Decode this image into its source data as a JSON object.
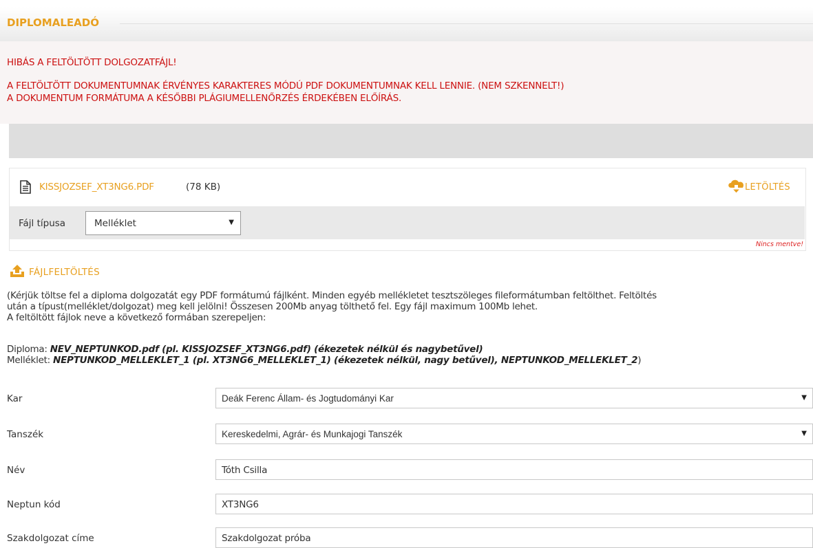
{
  "header": {
    "title": "DIPLOMALEADÓ"
  },
  "errors": {
    "line1": "HIBÁS A FELTÖLTÖTT DOLGOZATFÁJL!",
    "line2": "A FELTÖLTÖTT DOKUMENTUMNAK ÉRVÉNYES KARAKTERES MÓDÚ PDF DOKUMENTUMNAK KELL LENNIE. (NEM SZKENNELT!)",
    "line3": "A DOKUMENTUM FORMÁTUMA A KÉSŐBBI PLÁGIUMELLENŐRZÉS ÉRDEKÉBEN ELŐÍRÁS."
  },
  "file": {
    "name": "KISSJOZSEF_XT3NG6.PDF",
    "size": "(78 KB)",
    "download_label": "LETÖLTÉS",
    "type_label": "Fájl típusa",
    "type_value": "Melléklet",
    "status": "Nincs mentve!"
  },
  "upload": {
    "label": "FÁJLFELTÖLTÉS",
    "info_lines": [
      "(Kérjük töltse fel a diploma dolgozatát egy PDF formátumú fájlként. Minden egyéb mellékletet tesztszöleges fileformátumban feltölthet. Feltöltés",
      "után a típust(melléklet/dolgozat) meg kell jelölni! Összesen 200Mb anyag tölthető fel. Egy fájl maximum 100Mb lehet.",
      "A feltöltött fájlok neve a következő  formában szerepeljen:"
    ],
    "diploma_label": "Diploma: ",
    "diploma_pattern": "NEV_NEPTUNKOD.pdf   (pl. KISSJOZSEF_XT3NG6.pdf)  (ékezetek nélkül és nagybetűvel)",
    "melleklet_label": "Melléklet: ",
    "melleklet_pattern": "NEPTUNKOD_MELLEKLET_1  (pl. XT3NG6_MELLEKLET_1) (ékezetek nélkül, nagy betűvel), NEPTUNKOD_MELLEKLET_2",
    "melleklet_tail": ")"
  },
  "form": {
    "kar_label": "Kar",
    "kar_value": "Deák Ferenc Állam- és Jogtudományi Kar",
    "tanszek_label": "Tanszék",
    "tanszek_value": "Kereskedelmi, Agrár- és Munkajogi Tanszék",
    "nev_label": "Név",
    "nev_value": "Tóth Csilla",
    "neptun_label": "Neptun kód",
    "neptun_value": "XT3NG6",
    "cim_label": "Szakdolgozat címe",
    "cim_value": "Szakdolgozat próba"
  },
  "colors": {
    "accent": "#e8a020",
    "error": "#cc1111"
  },
  "icons": {
    "file": "document-icon",
    "download": "download-icon",
    "upload": "upload-icon",
    "dropdown": "chevron-down-icon"
  }
}
